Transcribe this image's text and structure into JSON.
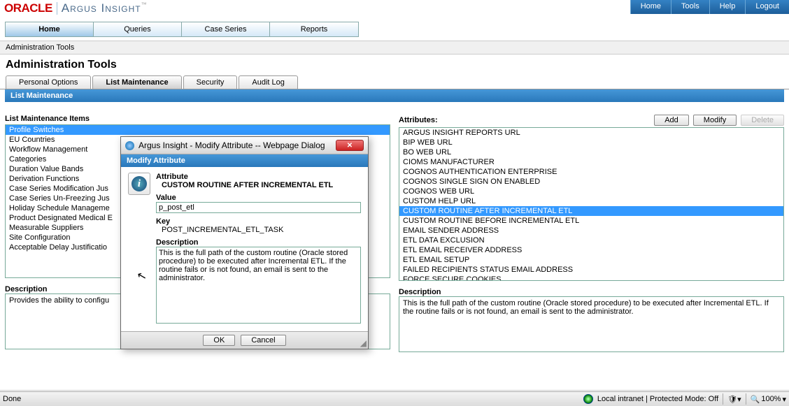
{
  "logo": {
    "oracle": "ORACLE",
    "product": "Argus Insight"
  },
  "topnav": {
    "home": "Home",
    "tools": "Tools",
    "help": "Help",
    "logout": "Logout"
  },
  "nav": {
    "home": "Home",
    "queries": "Queries",
    "caseseries": "Case Series",
    "reports": "Reports"
  },
  "breadcrumb": "Administration Tools",
  "pageTitle": "Administration Tools",
  "subtabs": {
    "personal": "Personal Options",
    "listmaint": "List Maintenance",
    "security": "Security",
    "auditlog": "Audit Log"
  },
  "sectionHeader": "List Maintenance",
  "left": {
    "header": "List Maintenance Items",
    "items": [
      "Profile Switches",
      "EU Countries",
      "Workflow Management",
      "Categories",
      "Duration Value Bands",
      "Derivation Functions",
      "Case Series Modification Jus",
      "Case Series Un-Freezing Jus",
      "Holiday Schedule Manageme",
      "Product Designated Medical E",
      "Measurable Suppliers",
      "Site Configuration",
      "Acceptable Delay Justificatio"
    ],
    "descLabel": "Description",
    "desc": "Provides the ability to configu"
  },
  "right": {
    "header": "Attributes:",
    "btns": {
      "add": "Add",
      "modify": "Modify",
      "delete": "Delete"
    },
    "items": [
      "ARGUS INSIGHT REPORTS URL",
      "BIP WEB URL",
      "BO WEB URL",
      "CIOMS MANUFACTURER",
      "COGNOS AUTHENTICATION ENTERPRISE",
      "COGNOS SINGLE SIGN ON ENABLED",
      "COGNOS WEB URL",
      "CUSTOM HELP URL",
      "CUSTOM ROUTINE AFTER INCREMENTAL ETL",
      "CUSTOM ROUTINE BEFORE INCREMENTAL ETL",
      "EMAIL SENDER ADDRESS",
      "ETL DATA EXCLUSION",
      "ETL EMAIL RECEIVER ADDRESS",
      "ETL EMAIL SETUP",
      "FAILED RECIPIENTS STATUS EMAIL ADDRESS",
      "FORCE SECURE COOKIES"
    ],
    "selectedIndex": 8,
    "descLabel": "Description",
    "desc": "This is the full path of the custom routine (Oracle stored procedure) to be executed after Incremental ETL. If the routine fails or is not found, an email is sent to the administrator."
  },
  "dialog": {
    "title": "Argus Insight - Modify Attribute -- Webpage Dialog",
    "sub": "Modify Attribute",
    "attrLabel": "Attribute",
    "attrValue": "CUSTOM ROUTINE AFTER INCREMENTAL ETL",
    "valueLabel": "Value",
    "valueInput": "p_post_etl",
    "keyLabel": "Key",
    "keyValue": "POST_INCREMENTAL_ETL_TASK",
    "descLabel": "Description",
    "descText": "This is the full path of the custom routine (Oracle stored procedure) to be executed after Incremental ETL. If the routine fails or is not found, an email is sent to the administrator.",
    "ok": "OK",
    "cancel": "Cancel"
  },
  "status": {
    "done": "Done",
    "zone": "Local intranet | Protected Mode: Off",
    "zoom": "100%"
  }
}
